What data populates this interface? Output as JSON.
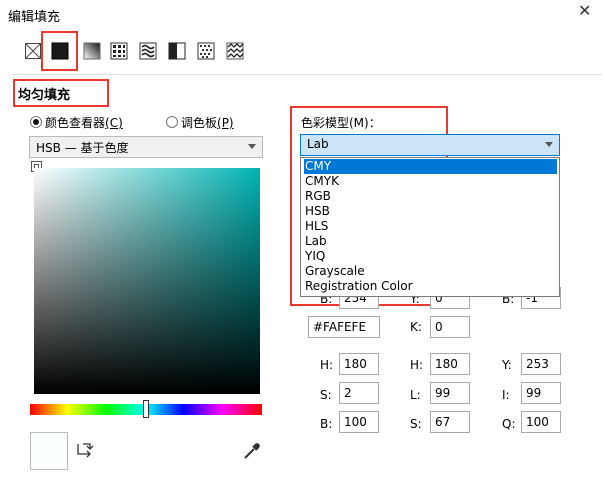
{
  "dialog": {
    "title": "编辑填充",
    "close_glyph": "✕"
  },
  "fill_types": [
    {
      "icon": "no-fill-icon"
    },
    {
      "icon": "uniform-fill-icon"
    },
    {
      "icon": "fountain-fill-icon"
    },
    {
      "icon": "vector-pattern-fill-icon"
    },
    {
      "icon": "bitmap-pattern-fill-icon"
    },
    {
      "icon": "two-color-pattern-fill-icon"
    },
    {
      "icon": "texture-fill-icon"
    },
    {
      "icon": "postscript-fill-icon"
    }
  ],
  "section": {
    "title": "均匀填充"
  },
  "mode": {
    "viewer_label": "颜色查看器",
    "viewer_key": "(C)",
    "palette_label": "调色板",
    "palette_key": "(P)",
    "selected": "viewer"
  },
  "viewer_combo": {
    "value": "HSB — 基于色度"
  },
  "model": {
    "label": "色彩模型(M)：",
    "selected": "Lab",
    "options": [
      "CMY",
      "CMYK",
      "RGB",
      "HSB",
      "HLS",
      "Lab",
      "YIQ",
      "Grayscale",
      "Registration Color"
    ],
    "highlighted": "CMY"
  },
  "values": {
    "rgb_b_label": "B:",
    "rgb_b": "254",
    "y_label": "Y:",
    "y": "0",
    "b2_label": "B:",
    "b2": "-1",
    "hex": "#FAFEFE",
    "k_label": "K:",
    "k": "0",
    "hsb": {
      "h_label": "H:",
      "h": "180",
      "s_label": "S:",
      "s": "2",
      "b_label": "B:",
      "b": "100"
    },
    "hls": {
      "h_label": "H:",
      "h": "180",
      "l_label": "L:",
      "l": "99",
      "s_label": "S:",
      "s": "67"
    },
    "yiq": {
      "y_label": "Y:",
      "y": "253",
      "i_label": "I:",
      "i": "99",
      "q_label": "Q:",
      "q": "100"
    }
  },
  "colors": {
    "accent_red": "#e8382f",
    "highlight_blue": "#0078d7",
    "current_color": "#FAFEFE"
  }
}
